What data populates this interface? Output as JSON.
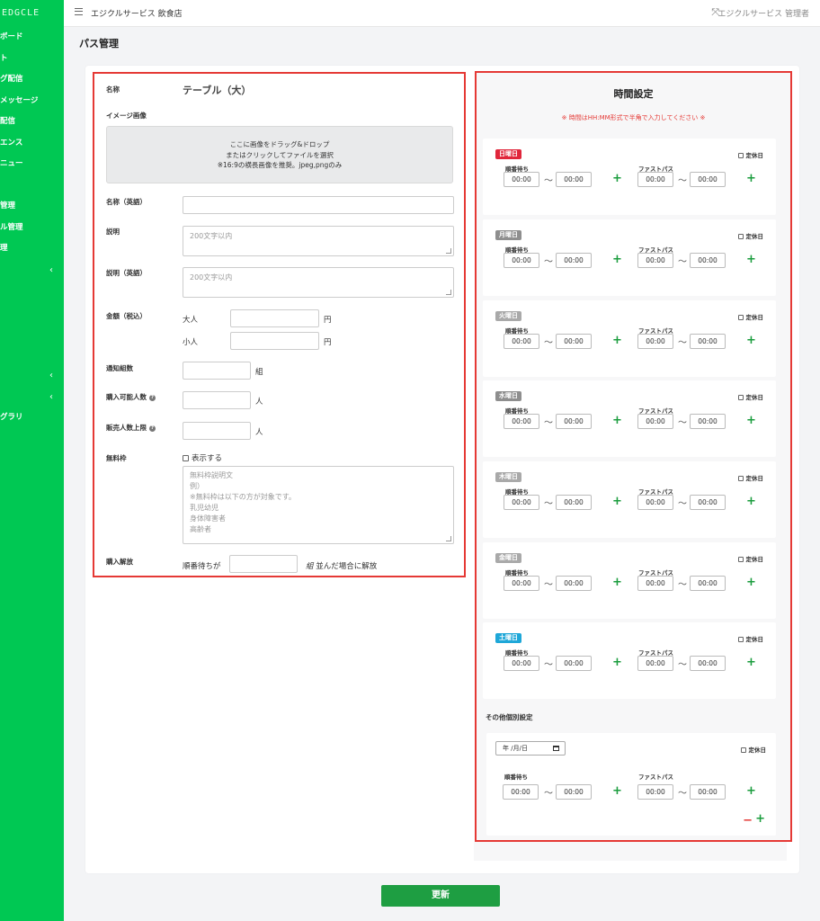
{
  "sidebar": {
    "brand": "EDGCLE",
    "items": [
      {
        "label": "ボード",
        "chevron": ""
      },
      {
        "label": "ト",
        "chevron": ""
      },
      {
        "label": "グ配信",
        "chevron": ""
      },
      {
        "label": "メッセージ",
        "chevron": ""
      },
      {
        "label": "配信",
        "chevron": ""
      },
      {
        "label": "エンス",
        "chevron": ""
      },
      {
        "label": "ニュー",
        "chevron": ""
      },
      {
        "label": "",
        "chevron": ""
      },
      {
        "label": "管理",
        "chevron": ""
      },
      {
        "label": "ル管理",
        "chevron": ""
      },
      {
        "label": "理",
        "chevron": ""
      },
      {
        "label": "",
        "chevron": "‹"
      },
      {
        "label": "",
        "chevron": ""
      },
      {
        "label": "",
        "chevron": ""
      },
      {
        "label": "",
        "chevron": ""
      },
      {
        "label": "",
        "chevron": ""
      },
      {
        "label": "",
        "chevron": "‹"
      },
      {
        "label": "",
        "chevron": "‹"
      },
      {
        "label": "グラリ",
        "chevron": ""
      }
    ]
  },
  "topbar": {
    "shop_name": "エジクルサービス 飲食店",
    "user_name": "エジクルサービス 管理者",
    "menu_icon": "hamburger-icon",
    "expand_icon": "expand-icon",
    "expand_glyph": "⤧"
  },
  "page_title": "パス管理",
  "form": {
    "name_label": "名称",
    "name_value": "テーブル（大）",
    "image_label": "イメージ画像",
    "dropzone": {
      "line1": "ここに画像をドラッグ&ドロップ",
      "line2": "またはクリックしてファイルを選択",
      "line3": "※16:9の横長画像を推奨。jpeg,pngのみ"
    },
    "name_en_label": "名称（英語）",
    "desc_label": "説明",
    "desc_placeholder": "200文字以内",
    "desc_en_label": "説明（英語）",
    "desc_en_placeholder": "200文字以内",
    "price_label": "金額（税込）",
    "adult_label": "大人",
    "child_label": "小人",
    "yen_unit": "円",
    "notify_label": "通知組数",
    "group_unit": "組",
    "max_purchase_label": "購入可能人数",
    "person_unit": "人",
    "sales_limit_label": "販売人数上限",
    "free_label": "無料枠",
    "show_label": "表示する",
    "free_placeholder": "無料枠説明文\n例）\n※無料枠は以下の方が対象です。\n乳児幼児\n身体障害者\n高齢者",
    "release_label": "購入解放",
    "release_prefix": "順番待ちが",
    "release_unit": "組",
    "release_suffix": "並んだ場合に解放"
  },
  "time_settings": {
    "title": "時間設定",
    "note": "※ 時間はHH:MM形式で半角で入力してください ※",
    "queue_label": "順番待ち",
    "fastpass_label": "ファストパス",
    "closed_label": "定休日",
    "tilde": "〜",
    "days": [
      {
        "name": "日曜日",
        "color": "#e0263b",
        "q_from": "00:00",
        "q_to": "00:00",
        "f_from": "00:00",
        "f_to": "00:00"
      },
      {
        "name": "月曜日",
        "color": "#8e8e8e",
        "q_from": "00:00",
        "q_to": "00:00",
        "f_from": "00:00",
        "f_to": "00:00"
      },
      {
        "name": "火曜日",
        "color": "#a9a9a9",
        "q_from": "00:00",
        "q_to": "00:00",
        "f_from": "00:00",
        "f_to": "00:00"
      },
      {
        "name": "水曜日",
        "color": "#8e8e8e",
        "q_from": "00:00",
        "q_to": "00:00",
        "f_from": "00:00",
        "f_to": "00:00"
      },
      {
        "name": "木曜日",
        "color": "#a9a9a9",
        "q_from": "00:00",
        "q_to": "00:00",
        "f_from": "00:00",
        "f_to": "00:00"
      },
      {
        "name": "金曜日",
        "color": "#a9a9a9",
        "q_from": "00:00",
        "q_to": "00:00",
        "f_from": "00:00",
        "f_to": "00:00"
      },
      {
        "name": "土曜日",
        "color": "#1ea7d8",
        "q_from": "00:00",
        "q_to": "00:00",
        "f_from": "00:00",
        "f_to": "00:00"
      }
    ],
    "other_label": "その他個別設定",
    "other": {
      "date_placeholder": "年 /月/日",
      "q_from": "00:00",
      "q_to": "00:00",
      "f_from": "00:00",
      "f_to": "00:00",
      "remove_glyph": "−",
      "add_glyph": "+"
    },
    "plus_glyph": "+"
  },
  "update_button": "更新",
  "colors": {
    "brand_green": "#00c853",
    "button_green": "#1e9e42",
    "highlight_red": "#e53935"
  }
}
